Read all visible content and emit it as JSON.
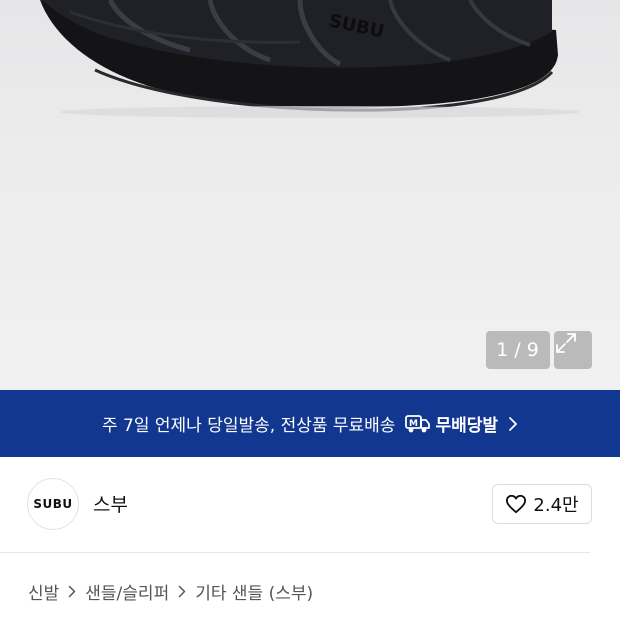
{
  "gallery": {
    "current": "1",
    "separator": "/",
    "total": "9",
    "expand_icon": "expand-arrows-icon",
    "product_logo_text": "SUBU"
  },
  "banner": {
    "text": "주 7일 언제나 당일발송, 전상품 무료배송",
    "badge_label": "무배당발",
    "badge_icon": "delivery-truck-icon",
    "background": "#123791"
  },
  "brand": {
    "logo_text": "SUBU",
    "name": "스부",
    "like_count": "2.4만",
    "like_icon": "heart-outline-icon"
  },
  "breadcrumb": {
    "items": [
      "신발",
      "샌들/슬리퍼",
      "기타 샌들 (스부)"
    ]
  }
}
